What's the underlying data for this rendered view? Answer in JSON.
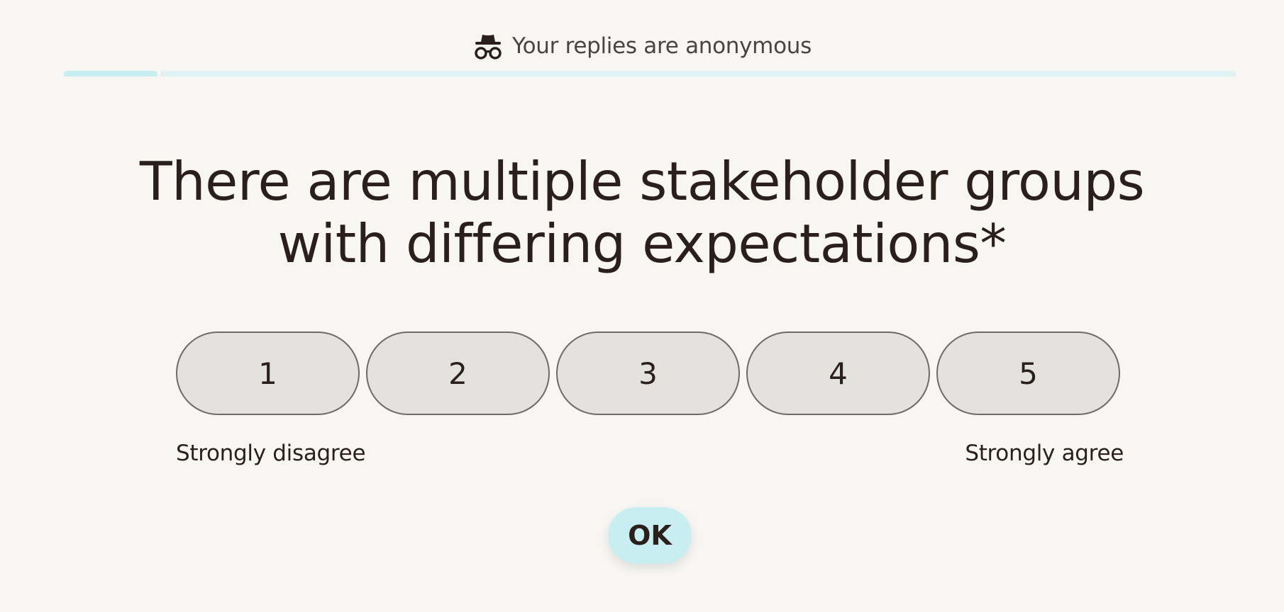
{
  "banner": {
    "icon": "incognito-icon",
    "text": "Your replies are anonymous"
  },
  "progress": {
    "fraction": 0.08
  },
  "question": {
    "text": "There are multiple stakeholder groups with differing expectations*"
  },
  "scale": {
    "options": [
      "1",
      "2",
      "3",
      "4",
      "5"
    ],
    "min_label": "Strongly disagree",
    "max_label": "Strongly agree"
  },
  "submit": {
    "label": "OK"
  },
  "colors": {
    "background": "#f7f6f3",
    "accent": "#c8eef2",
    "text": "#2b1f1b",
    "option_fill": "#e3e2de"
  }
}
